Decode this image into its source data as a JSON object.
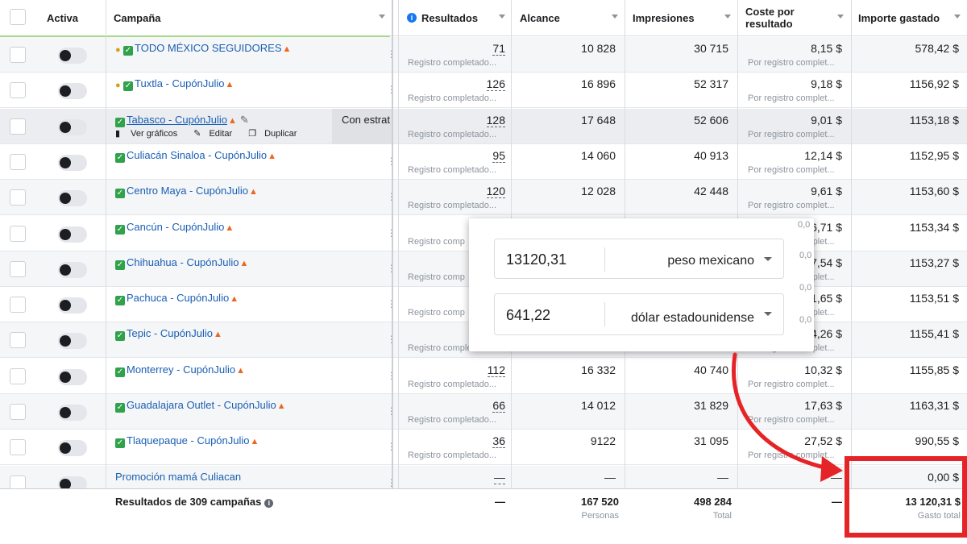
{
  "header": {
    "activa": "Activa",
    "campana": "Campaña",
    "resultados": "Resultados",
    "alcance": "Alcance",
    "impresiones": "Impresiones",
    "coste": "Coste por resultado",
    "importe": "Importe gastado"
  },
  "rows": [
    {
      "name": "TODO MÉXICO SEGUIDORES",
      "res": "71",
      "res_label": "Registro completado...",
      "alc": "10 828",
      "imp": "30 715",
      "cost": "8,15 $",
      "cost_label": "Por registro complet...",
      "spent": "578,42 $"
    },
    {
      "name": "Tuxtla - CupónJulio",
      "res": "126",
      "res_label": "Registro completado...",
      "alc": "16 896",
      "imp": "52 317",
      "cost": "9,18 $",
      "cost_label": "Por registro complet...",
      "spent": "1156,92 $"
    },
    {
      "name": "Tabasco - CupónJulio",
      "res": "128",
      "res_label": "Registro completado...",
      "alc": "17 648",
      "imp": "52 606",
      "cost": "9,01 $",
      "cost_label": "Por registro complet...",
      "spent": "1153,18 $",
      "actions": [
        "Ver gráficos",
        "Editar",
        "Duplicar"
      ],
      "strategy": "Con estrat"
    },
    {
      "name": "Culiacán Sinaloa - CupónJulio",
      "res": "95",
      "res_label": "Registro completado...",
      "alc": "14 060",
      "imp": "40 913",
      "cost": "12,14 $",
      "cost_label": "Por registro complet...",
      "spent": "1152,95 $"
    },
    {
      "name": "Centro Maya - CupónJulio",
      "res": "120",
      "res_label": "Registro completado...",
      "alc": "12 028",
      "imp": "42 448",
      "cost": "9,61 $",
      "cost_label": "Por registro complet...",
      "spent": "1153,60 $"
    },
    {
      "name": "Cancún - CupónJulio",
      "res": "",
      "res_label": "Registro comp",
      "alc": "",
      "imp": "",
      "cost": "6,71 $",
      "cost_label": "Por registro complet...",
      "spent": "1153,34 $"
    },
    {
      "name": "Chihuahua - CupónJulio",
      "res": "",
      "res_label": "Registro comp",
      "alc": "",
      "imp": "",
      "cost": "17,54 $",
      "cost_label": "Por registro complet...",
      "spent": "1153,27 $"
    },
    {
      "name": "Pachuca - CupónJulio",
      "res": "",
      "res_label": "Registro comp",
      "alc": "",
      "imp": "",
      "cost": "11,65 $",
      "cost_label": "Por registro complet...",
      "spent": "1153,51 $"
    },
    {
      "name": "Tepic - CupónJulio",
      "res": "",
      "res_label": "Registro completado...",
      "alc": "",
      "imp": "",
      "cost": "14,26 $",
      "cost_label": "Por registro complet...",
      "spent": "1155,41 $"
    },
    {
      "name": "Monterrey - CupónJulio",
      "res": "112",
      "res_label": "Registro completado...",
      "alc": "16 332",
      "imp": "40 740",
      "cost": "10,32 $",
      "cost_label": "Por registro complet...",
      "spent": "1155,85 $"
    },
    {
      "name": "Guadalajara Outlet - CupónJulio",
      "res": "66",
      "res_label": "Registro completado...",
      "alc": "14 012",
      "imp": "31 829",
      "cost": "17,63 $",
      "cost_label": "Por registro complet...",
      "spent": "1163,31 $"
    },
    {
      "name": "Tlaquepaque - CupónJulio",
      "res": "36",
      "res_label": "Registro completado...",
      "alc": "9122",
      "imp": "31 095",
      "cost": "27,52 $",
      "cost_label": "Por registro complet...",
      "spent": "990,55 $"
    },
    {
      "name": "Promoción mamá Culiacan",
      "res": "—",
      "res_label": "",
      "alc": "—",
      "imp": "—",
      "cost": "—",
      "cost_label": "",
      "spent": "0,00 $"
    }
  ],
  "totals": {
    "label": "Resultados de 309 campañas",
    "res": "—",
    "alc": "167 520",
    "alc_sub": "Personas",
    "imp": "498 284",
    "imp_sub": "Total",
    "cost": "—",
    "spent": "13 120,31 $",
    "spent_sub": "Gasto total"
  },
  "converter": {
    "amount1": "13120,31",
    "currency1": "peso mexicano",
    "amount2": "641,22",
    "currency2": "dólar estadounidense",
    "ghost": "0,0"
  },
  "colors": {
    "link": "#1a5fb4",
    "highlight": "#e52427"
  }
}
